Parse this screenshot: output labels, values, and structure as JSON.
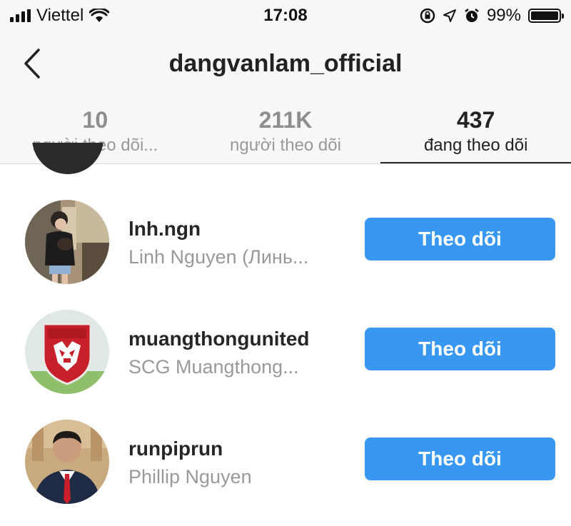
{
  "status": {
    "carrier": "Viettel",
    "time": "17:08",
    "battery": "99%",
    "battery_level": 0.99
  },
  "header": {
    "title": "dangvanlam_official",
    "back_icon": "chevron-left-icon"
  },
  "tabs": [
    {
      "count": "10",
      "label": "người theo dõi...",
      "active": false
    },
    {
      "count": "211K",
      "label": "người theo dõi",
      "active": false
    },
    {
      "count": "437",
      "label": "đang theo dõi",
      "active": true
    }
  ],
  "users": [
    {
      "username": "lnh.ngn",
      "full_name": "Linh Nguyen (Линь...",
      "button": "Theo dõi"
    },
    {
      "username": "muangthongunited",
      "full_name": "SCG Muangthong...",
      "button": "Theo dõi"
    },
    {
      "username": "runpiprun",
      "full_name": "Phillip Nguyen",
      "button": "Theo dõi"
    }
  ],
  "colors": {
    "accent": "#3897f0",
    "header_bg": "#f7f7f7",
    "muted_text": "#999999"
  }
}
